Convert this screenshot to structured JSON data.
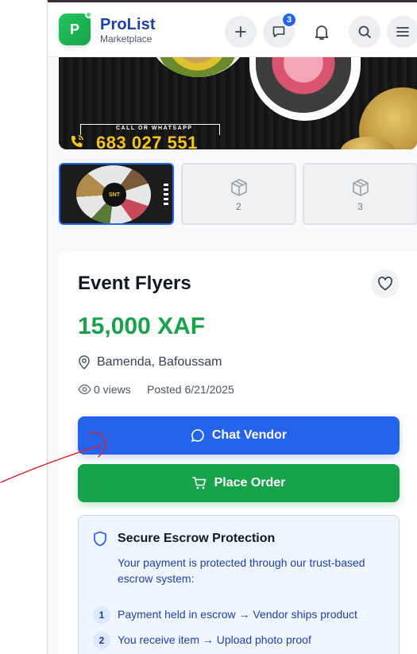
{
  "header": {
    "logo_letter": "P",
    "brand": "ProList",
    "brand_sub": "Marketplace",
    "actions": [
      "plus-icon",
      "chat-icon",
      "bell-icon",
      "search-icon",
      "menu-icon"
    ],
    "messages_badge": "3"
  },
  "hero": {
    "call_label": "CALL OR WHATSAPP",
    "phone": "683 027 551"
  },
  "gallery": {
    "thumbnails": [
      {
        "label": "",
        "active": true,
        "badge": "SNT"
      },
      {
        "label": "2",
        "active": false
      },
      {
        "label": "3",
        "active": false
      }
    ]
  },
  "product": {
    "title": "Event Flyers",
    "price": "15,000 XAF",
    "location": "Bamenda, Bafoussam",
    "views": "0 views",
    "posted": "Posted 6/21/2025"
  },
  "actions": {
    "chat_label": "Chat Vendor",
    "order_label": "Place Order"
  },
  "escrow": {
    "title": "Secure Escrow Protection",
    "description": "Your payment is protected through our trust-based escrow system:",
    "steps": [
      {
        "num": "1",
        "text": "Payment held in escrow → Vendor ships product"
      },
      {
        "num": "2",
        "text": "You receive item → Upload photo proof"
      }
    ]
  },
  "colors": {
    "brand_blue": "#1e40af",
    "primary": "#2563eb",
    "success": "#16a34a",
    "annotation": "#e11d2a"
  }
}
